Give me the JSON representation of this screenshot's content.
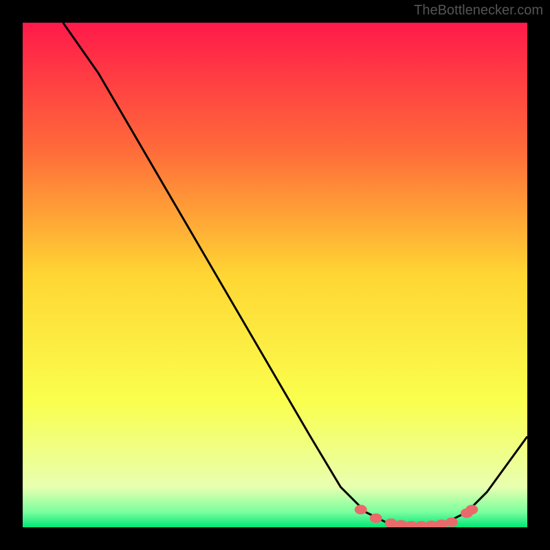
{
  "watermark": "TheBottlenecker.com",
  "chart_data": {
    "type": "line",
    "title": "",
    "xlabel": "",
    "ylabel": "",
    "xlim": [
      0,
      100
    ],
    "ylim": [
      0,
      100
    ],
    "curve": [
      {
        "x": 8,
        "y": 100
      },
      {
        "x": 15,
        "y": 90
      },
      {
        "x": 57,
        "y": 18
      },
      {
        "x": 63,
        "y": 8
      },
      {
        "x": 68,
        "y": 3
      },
      {
        "x": 72,
        "y": 1
      },
      {
        "x": 76,
        "y": 0.3
      },
      {
        "x": 80,
        "y": 0.3
      },
      {
        "x": 84,
        "y": 1
      },
      {
        "x": 88,
        "y": 3
      },
      {
        "x": 92,
        "y": 7
      },
      {
        "x": 100,
        "y": 18
      }
    ],
    "dots": [
      {
        "x": 67,
        "y": 3.5
      },
      {
        "x": 70,
        "y": 1.8
      },
      {
        "x": 73,
        "y": 0.8
      },
      {
        "x": 75,
        "y": 0.5
      },
      {
        "x": 77,
        "y": 0.3
      },
      {
        "x": 79,
        "y": 0.3
      },
      {
        "x": 81,
        "y": 0.4
      },
      {
        "x": 83,
        "y": 0.6
      },
      {
        "x": 85,
        "y": 1.0
      },
      {
        "x": 88,
        "y": 2.8
      },
      {
        "x": 89,
        "y": 3.5
      }
    ],
    "gradient_stops": [
      {
        "offset": 0,
        "color": "#ff1a4a"
      },
      {
        "offset": 0.25,
        "color": "#ff6a3a"
      },
      {
        "offset": 0.5,
        "color": "#ffd633"
      },
      {
        "offset": 0.75,
        "color": "#faff4d"
      },
      {
        "offset": 0.92,
        "color": "#e8ffb0"
      },
      {
        "offset": 0.97,
        "color": "#7aff9e"
      },
      {
        "offset": 1.0,
        "color": "#00e676"
      }
    ]
  }
}
